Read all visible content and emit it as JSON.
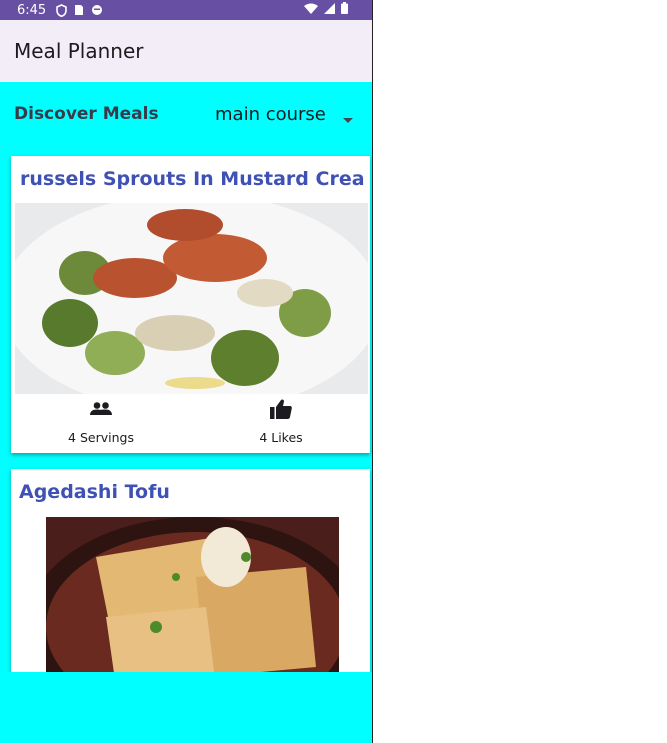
{
  "status_bar": {
    "time": "6:45",
    "icons": [
      "shield-icon",
      "sim-card-icon",
      "circle-app-icon",
      "wifi-icon",
      "signal-icon",
      "battery-icon"
    ],
    "bg_color": "#6750A4"
  },
  "app_bar": {
    "title": "Meal Planner",
    "bg_color": "#F3EDF7"
  },
  "filter": {
    "label": "Discover Meals",
    "selected": "main course"
  },
  "colors": {
    "page_bg": "#00FFFF",
    "card_title": "#3F51B5"
  },
  "meals": [
    {
      "title": "russels Sprouts In Mustard Cream S",
      "servings_label": "4 Servings",
      "likes_label": "4 Likes"
    },
    {
      "title": "Agedashi Tofu"
    }
  ]
}
